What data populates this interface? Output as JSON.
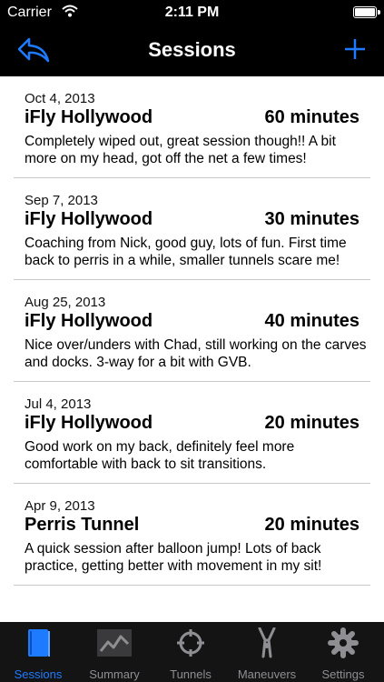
{
  "status_bar": {
    "carrier": "Carrier",
    "time": "2:11 PM"
  },
  "nav": {
    "title": "Sessions",
    "back_icon": "back-arrow-icon",
    "add_icon": "plus-icon",
    "accent": "#1e7bff"
  },
  "sessions": [
    {
      "date": "Oct 4, 2013",
      "location": "iFly Hollywood",
      "duration": "60 minutes",
      "note": "Completely wiped out, great session though!! A bit more on my head, got off the net a few times!"
    },
    {
      "date": "Sep 7, 2013",
      "location": "iFly Hollywood",
      "duration": "30 minutes",
      "note": "Coaching from Nick, good guy, lots of fun. First time back to perris in a while, smaller tunnels scare me!"
    },
    {
      "date": "Aug 25, 2013",
      "location": "iFly Hollywood",
      "duration": "40 minutes",
      "note": "Nice over/unders with Chad, still working on the carves and docks. 3-way for a bit with GVB."
    },
    {
      "date": "Jul 4, 2013",
      "location": "iFly Hollywood",
      "duration": "20 minutes",
      "note": "Good work on my back, definitely feel more comfortable with back to sit transitions."
    },
    {
      "date": "Apr 9, 2013",
      "location": "Perris Tunnel",
      "duration": "20 minutes",
      "note": "A quick session after balloon jump! Lots of back practice, getting better with movement in my sit!"
    }
  ],
  "tabs": [
    {
      "label": "Sessions",
      "icon": "book-icon",
      "active": true
    },
    {
      "label": "Summary",
      "icon": "chart-icon",
      "active": false
    },
    {
      "label": "Tunnels",
      "icon": "crosshair-icon",
      "active": false
    },
    {
      "label": "Maneuvers",
      "icon": "figure-icon",
      "active": false
    },
    {
      "label": "Settings",
      "icon": "gear-icon",
      "active": false
    }
  ]
}
